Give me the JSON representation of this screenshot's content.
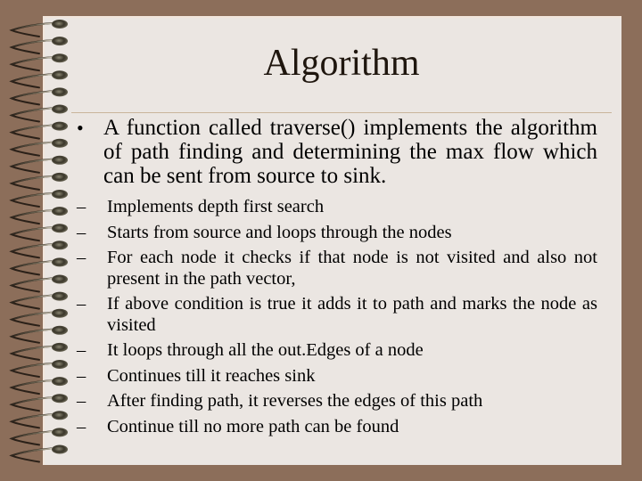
{
  "slide": {
    "title": "Algorithm",
    "bullets": [
      {
        "marker": "•",
        "text": "A function called traverse() implements the algorithm of path finding and determining the max flow which can be sent from source to sink.",
        "subitems": [
          {
            "marker": "–",
            "text": "Implements depth first search"
          },
          {
            "marker": "–",
            "text": "Starts from source and loops through the nodes"
          },
          {
            "marker": "–",
            "text": "For each node it checks if that node is not visited  and also not present in the path vector,"
          },
          {
            "marker": "–",
            "text": "If above condition is true it adds it to path  and  marks the node as visited"
          },
          {
            "marker": "–",
            "text": "It loops through all the out.Edges of a node"
          },
          {
            "marker": "–",
            "text": "Continues till it reaches sink"
          },
          {
            "marker": "–",
            "text": "After finding path, it reverses the edges of this path"
          },
          {
            "marker": "–",
            "text": "Continue till no more path can be found"
          }
        ]
      }
    ]
  },
  "theme": {
    "background_color": "#8c6e5a",
    "page_color": "#ebe6e2",
    "title_color": "#1f160e",
    "divider_color": "#c9b49a",
    "decoration": "spiral-notebook-binding"
  }
}
